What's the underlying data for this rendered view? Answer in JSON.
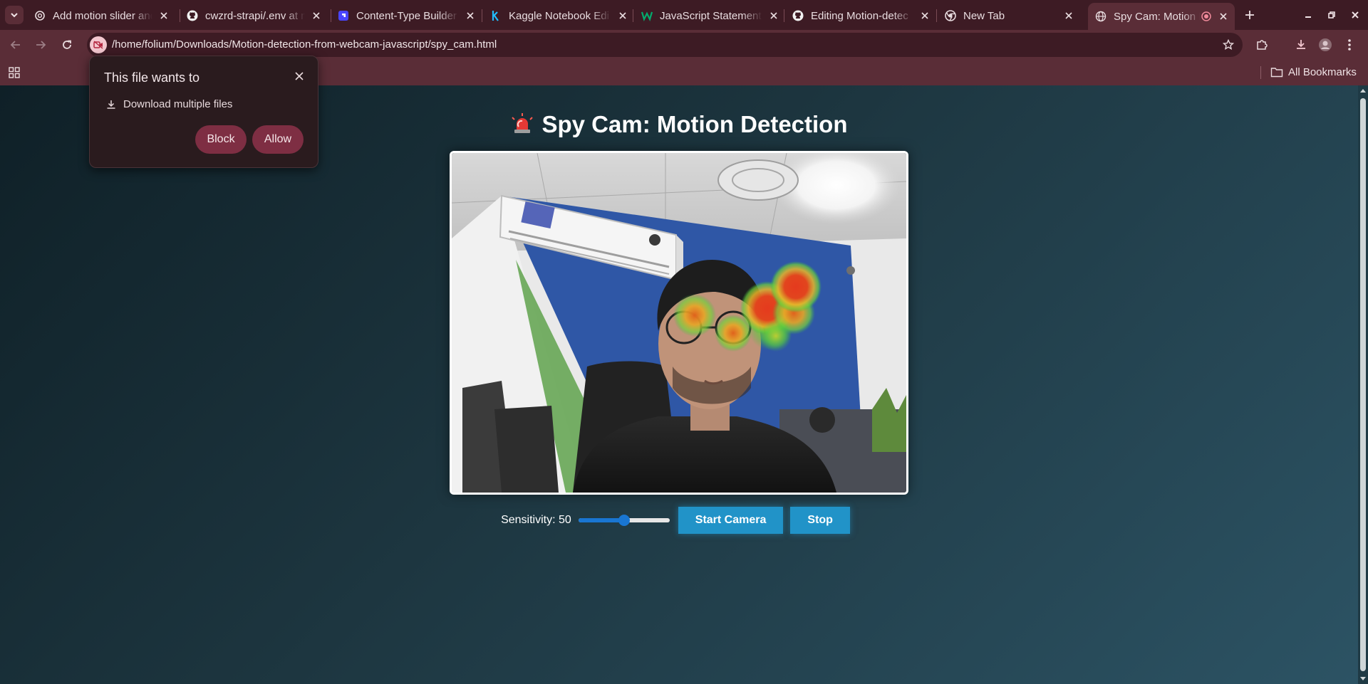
{
  "browser": {
    "tabs": [
      {
        "title": "Add motion slider and",
        "icon": "openai-icon"
      },
      {
        "title": "cwzrd-strapi/.env at m",
        "icon": "github-icon"
      },
      {
        "title": "Content-Type Builder",
        "icon": "strapi-icon"
      },
      {
        "title": "Kaggle Notebook Edi",
        "icon": "kaggle-icon"
      },
      {
        "title": "JavaScript Statement",
        "icon": "w3schools-icon"
      },
      {
        "title": "Editing Motion-detec",
        "icon": "github-icon"
      },
      {
        "title": "New Tab",
        "icon": "chrome-icon"
      },
      {
        "title": "Spy Cam: Motion D",
        "icon": "globe-icon",
        "active": true,
        "recording": true
      }
    ],
    "url": "/home/folium/Downloads/Motion-detection-from-webcam-javascript/spy_cam.html",
    "bookmarks": {
      "all_label": "All Bookmarks"
    },
    "theme_colors": {
      "frame": "#3d1b24",
      "toolbar": "#5a2d37",
      "popup": "#2a1b1e",
      "popup_button": "#7e2e43"
    }
  },
  "permission_popup": {
    "title": "This file wants to",
    "request": "Download multiple files",
    "block_label": "Block",
    "allow_label": "Allow"
  },
  "app": {
    "title": "Spy Cam: Motion Detection",
    "title_icon": "rotating-light-icon",
    "sensitivity_label": "Sensitivity: 50",
    "sensitivity_value": 50,
    "sensitivity_min": 0,
    "sensitivity_max": 100,
    "start_label": "Start Camera",
    "stop_label": "Stop",
    "accent_color": "#2193c8"
  }
}
